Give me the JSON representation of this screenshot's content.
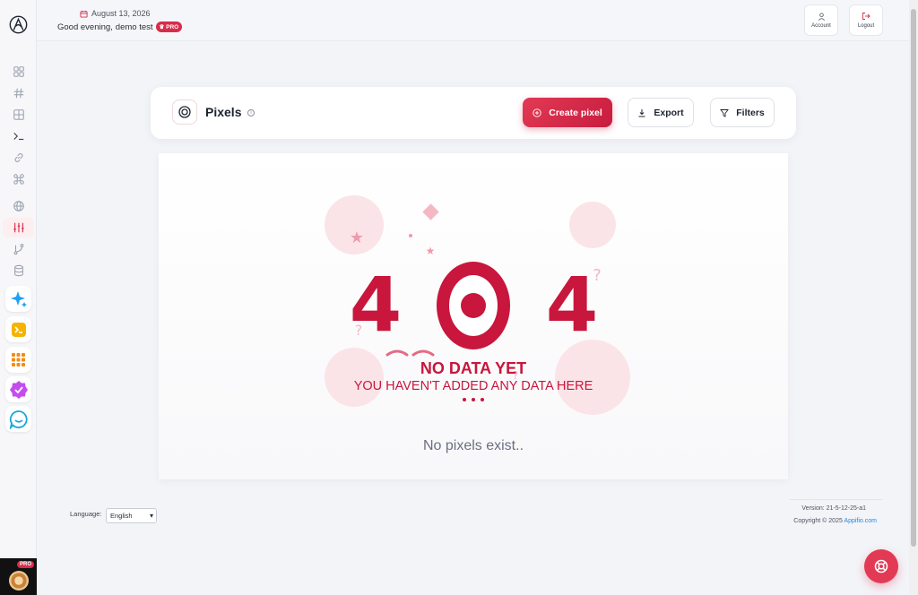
{
  "header": {
    "date": "August 13, 2026",
    "greeting_prefix": "Good evening,",
    "user_name": "demo test",
    "pro_badge": "PRO",
    "account_label": "Account",
    "logout_label": "Logout"
  },
  "sidebar": {
    "items": [
      {
        "icon": "dashboard-grid-icon"
      },
      {
        "icon": "hashtag-icon"
      },
      {
        "icon": "table-grid-icon"
      },
      {
        "icon": "terminal-icon"
      },
      {
        "icon": "link-icon"
      },
      {
        "icon": "command-icon"
      },
      {
        "icon": "globe-icon"
      },
      {
        "icon": "sliders-icon",
        "active": true
      },
      {
        "icon": "git-branch-icon"
      },
      {
        "icon": "database-icon"
      }
    ],
    "apps": [
      {
        "icon": "sparkle-ai-icon",
        "color": "#1da1f2"
      },
      {
        "icon": "terminal-app-icon",
        "color": "#f5b400"
      },
      {
        "icon": "apps-grid-icon",
        "color": "#f08c1a"
      },
      {
        "icon": "verified-badge-icon",
        "color": "#c44cf0"
      },
      {
        "icon": "chat-bubble-icon",
        "color": "#17a7d8"
      }
    ],
    "avatar_badge": "PRO"
  },
  "toolbar": {
    "title": "Pixels",
    "info": "i",
    "create_label": "Create pixel",
    "export_label": "Export",
    "filters_label": "Filters"
  },
  "empty_state": {
    "digits": [
      "4",
      "0",
      "4"
    ],
    "title": "NO DATA YET",
    "subtitle": "YOU HAVEN'T ADDED ANY DATA HERE",
    "message": "No pixels exist.."
  },
  "footer": {
    "language_label": "Language:",
    "language_value": "English",
    "version": "Version: 21-5-12-25-a1",
    "copyright_prefix": "Copyright © 2025",
    "copyright_link": "Appifio.com"
  },
  "colors": {
    "accent": "#d72c4b",
    "accent_dark": "#c8163c",
    "link": "#1e88e5"
  }
}
